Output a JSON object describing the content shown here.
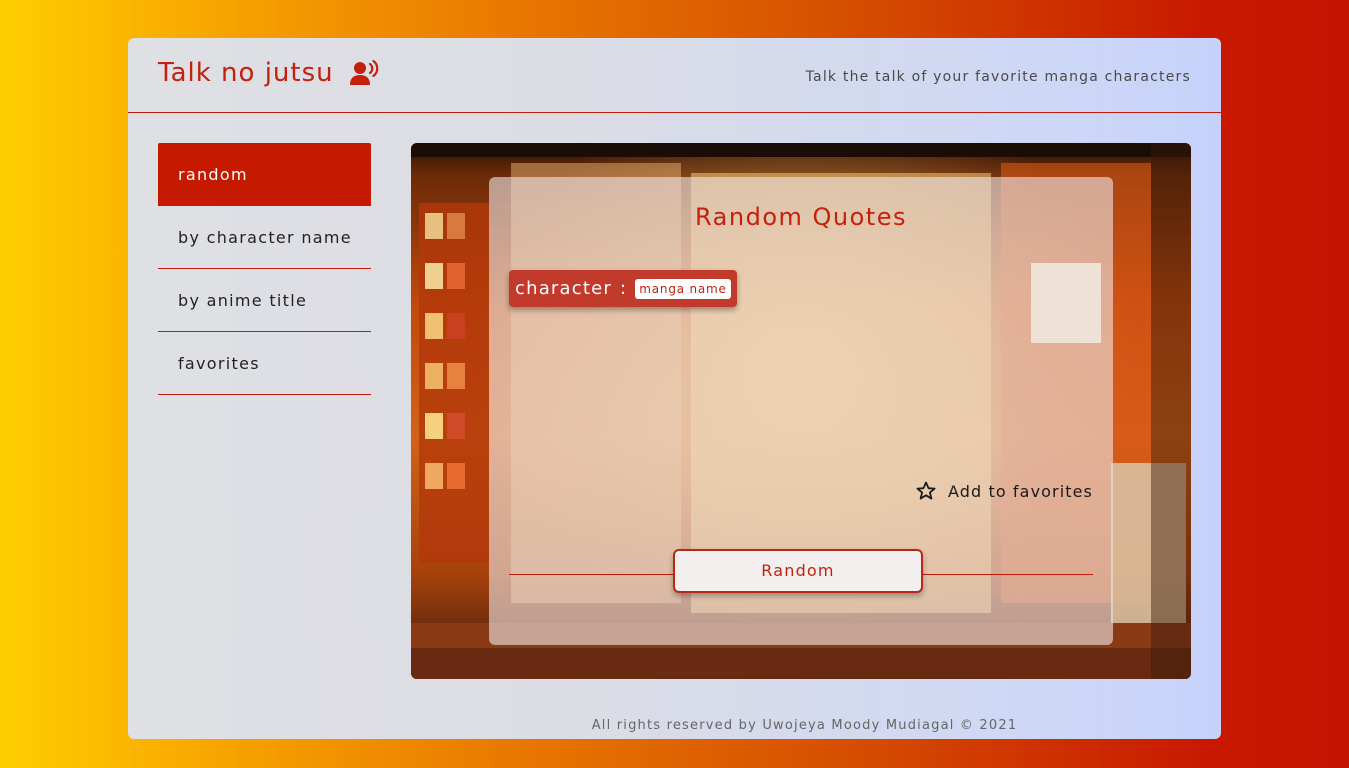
{
  "header": {
    "brand": "Talk no jutsu",
    "brand_icon": "person-speaking-icon",
    "tagline": "Talk the talk of your favorite manga characters"
  },
  "sidebar": {
    "items": [
      {
        "label": "random",
        "active": true
      },
      {
        "label": "by character name",
        "active": false
      },
      {
        "label": "by anime title",
        "active": false
      },
      {
        "label": "favorites",
        "active": false
      }
    ]
  },
  "main": {
    "title": "Random Quotes",
    "character_label": "character",
    "separator": ":",
    "manga_label": "manga name",
    "favorite_label": "Add to favorites",
    "favorite_icon": "star-outline-icon",
    "random_button": "Random"
  },
  "footer": {
    "text": "All rights reserved by Uwojeya Moody Mudiagal © 2021"
  },
  "colors": {
    "accent": "#c51a00",
    "text_dark": "#222222",
    "card_bg": "#dfe0e4"
  }
}
